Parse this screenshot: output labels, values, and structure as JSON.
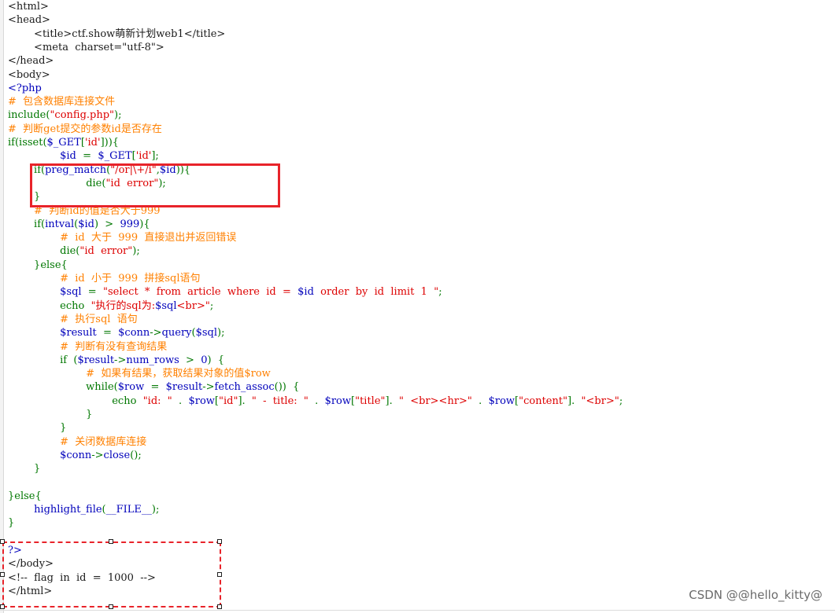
{
  "colors": {
    "default": "#1a1a1a",
    "tag": "#1a1a1a",
    "php": "#0000bb",
    "keyword": "#007700",
    "string": "#dd0000",
    "comment": "#ff8000",
    "highlight_box": "#e8232a"
  },
  "code_lines": [
    [
      {
        "t": "<html>",
        "c": "default"
      }
    ],
    [
      {
        "t": "<head>",
        "c": "default"
      }
    ],
    [
      {
        "t": "        <title>ctf.show萌新计划web1</title>",
        "c": "default"
      }
    ],
    [
      {
        "t": "        <meta  charset=\"utf-8\">",
        "c": "default"
      }
    ],
    [
      {
        "t": "</head>",
        "c": "default"
      }
    ],
    [
      {
        "t": "<body>",
        "c": "default"
      }
    ],
    [
      {
        "t": "<?php",
        "c": "php"
      }
    ],
    [
      {
        "t": "#  包含数据库连接文件",
        "c": "comment"
      }
    ],
    [
      {
        "t": "include(",
        "c": "keyword"
      },
      {
        "t": "\"config.php\"",
        "c": "string"
      },
      {
        "t": ");",
        "c": "keyword"
      }
    ],
    [
      {
        "t": "#  判断get提交的参数id是否存在",
        "c": "comment"
      }
    ],
    [
      {
        "t": "if(isset(",
        "c": "keyword"
      },
      {
        "t": "$_GET",
        "c": "php"
      },
      {
        "t": "[",
        "c": "keyword"
      },
      {
        "t": "'id'",
        "c": "string"
      },
      {
        "t": "])){",
        "c": "keyword"
      }
    ],
    [
      {
        "t": "                ",
        "c": "default"
      },
      {
        "t": "$id",
        "c": "php"
      },
      {
        "t": "  =  ",
        "c": "keyword"
      },
      {
        "t": "$_GET",
        "c": "php"
      },
      {
        "t": "[",
        "c": "keyword"
      },
      {
        "t": "'id'",
        "c": "string"
      },
      {
        "t": "];",
        "c": "keyword"
      }
    ],
    [
      {
        "t": "        if(",
        "c": "keyword"
      },
      {
        "t": "preg_match",
        "c": "php"
      },
      {
        "t": "(",
        "c": "keyword"
      },
      {
        "t": "\"/or|\\+/i\"",
        "c": "string"
      },
      {
        "t": ",",
        "c": "keyword"
      },
      {
        "t": "$id",
        "c": "php"
      },
      {
        "t": ")){",
        "c": "keyword"
      }
    ],
    [
      {
        "t": "                        ",
        "c": "default"
      },
      {
        "t": "die(",
        "c": "keyword"
      },
      {
        "t": "\"id  error\"",
        "c": "string"
      },
      {
        "t": ");",
        "c": "keyword"
      }
    ],
    [
      {
        "t": "        }",
        "c": "keyword"
      }
    ],
    [
      {
        "t": "        #  判断id的值是否大于999",
        "c": "comment"
      }
    ],
    [
      {
        "t": "        if(",
        "c": "keyword"
      },
      {
        "t": "intval",
        "c": "php"
      },
      {
        "t": "(",
        "c": "keyword"
      },
      {
        "t": "$id",
        "c": "php"
      },
      {
        "t": ")  >  ",
        "c": "keyword"
      },
      {
        "t": "999",
        "c": "php"
      },
      {
        "t": "){",
        "c": "keyword"
      }
    ],
    [
      {
        "t": "                #  id  大于  999  直接退出并返回错误",
        "c": "comment"
      }
    ],
    [
      {
        "t": "                ",
        "c": "default"
      },
      {
        "t": "die(",
        "c": "keyword"
      },
      {
        "t": "\"id  error\"",
        "c": "string"
      },
      {
        "t": ");",
        "c": "keyword"
      }
    ],
    [
      {
        "t": "        }else{",
        "c": "keyword"
      }
    ],
    [
      {
        "t": "                #  id  小于  999  拼接sql语句",
        "c": "comment"
      }
    ],
    [
      {
        "t": "                ",
        "c": "default"
      },
      {
        "t": "$sql",
        "c": "php"
      },
      {
        "t": "  =  ",
        "c": "keyword"
      },
      {
        "t": "\"select  *  from  article  where  id  =  ",
        "c": "string"
      },
      {
        "t": "$id",
        "c": "php"
      },
      {
        "t": "  order  by  id  limit  1  \"",
        "c": "string"
      },
      {
        "t": ";",
        "c": "keyword"
      }
    ],
    [
      {
        "t": "                ",
        "c": "default"
      },
      {
        "t": "echo  ",
        "c": "keyword"
      },
      {
        "t": "\"执行的sql为:",
        "c": "string"
      },
      {
        "t": "$sql",
        "c": "php"
      },
      {
        "t": "<br>\"",
        "c": "string"
      },
      {
        "t": ";",
        "c": "keyword"
      }
    ],
    [
      {
        "t": "                #  执行sql  语句",
        "c": "comment"
      }
    ],
    [
      {
        "t": "                ",
        "c": "default"
      },
      {
        "t": "$result",
        "c": "php"
      },
      {
        "t": "  =  ",
        "c": "keyword"
      },
      {
        "t": "$conn",
        "c": "php"
      },
      {
        "t": "->",
        "c": "keyword"
      },
      {
        "t": "query",
        "c": "php"
      },
      {
        "t": "(",
        "c": "keyword"
      },
      {
        "t": "$sql",
        "c": "php"
      },
      {
        "t": ");",
        "c": "keyword"
      }
    ],
    [
      {
        "t": "                #  判断有没有查询结果",
        "c": "comment"
      }
    ],
    [
      {
        "t": "                if  (",
        "c": "keyword"
      },
      {
        "t": "$result",
        "c": "php"
      },
      {
        "t": "->",
        "c": "keyword"
      },
      {
        "t": "num_rows",
        "c": "php"
      },
      {
        "t": "  >  ",
        "c": "keyword"
      },
      {
        "t": "0",
        "c": "php"
      },
      {
        "t": ")  {",
        "c": "keyword"
      }
    ],
    [
      {
        "t": "                        #  如果有结果，获取结果对象的值$row",
        "c": "comment"
      }
    ],
    [
      {
        "t": "                        while(",
        "c": "keyword"
      },
      {
        "t": "$row",
        "c": "php"
      },
      {
        "t": "  =  ",
        "c": "keyword"
      },
      {
        "t": "$result",
        "c": "php"
      },
      {
        "t": "->",
        "c": "keyword"
      },
      {
        "t": "fetch_assoc",
        "c": "php"
      },
      {
        "t": "())  {",
        "c": "keyword"
      }
    ],
    [
      {
        "t": "                                ",
        "c": "default"
      },
      {
        "t": "echo  ",
        "c": "keyword"
      },
      {
        "t": "\"id:  \"",
        "c": "string"
      },
      {
        "t": "  .  ",
        "c": "keyword"
      },
      {
        "t": "$row",
        "c": "php"
      },
      {
        "t": "[",
        "c": "keyword"
      },
      {
        "t": "\"id\"",
        "c": "string"
      },
      {
        "t": "].  ",
        "c": "keyword"
      },
      {
        "t": "\"  -  title:  \"",
        "c": "string"
      },
      {
        "t": "  .  ",
        "c": "keyword"
      },
      {
        "t": "$row",
        "c": "php"
      },
      {
        "t": "[",
        "c": "keyword"
      },
      {
        "t": "\"title\"",
        "c": "string"
      },
      {
        "t": "].  ",
        "c": "keyword"
      },
      {
        "t": "\"  <br><hr>\"",
        "c": "string"
      },
      {
        "t": "  .  ",
        "c": "keyword"
      },
      {
        "t": "$row",
        "c": "php"
      },
      {
        "t": "[",
        "c": "keyword"
      },
      {
        "t": "\"content\"",
        "c": "string"
      },
      {
        "t": "].  ",
        "c": "keyword"
      },
      {
        "t": "\"<br>\"",
        "c": "string"
      },
      {
        "t": ";",
        "c": "keyword"
      }
    ],
    [
      {
        "t": "                        }",
        "c": "keyword"
      }
    ],
    [
      {
        "t": "                }",
        "c": "keyword"
      }
    ],
    [
      {
        "t": "                #  关闭数据库连接",
        "c": "comment"
      }
    ],
    [
      {
        "t": "                ",
        "c": "default"
      },
      {
        "t": "$conn",
        "c": "php"
      },
      {
        "t": "->",
        "c": "keyword"
      },
      {
        "t": "close",
        "c": "php"
      },
      {
        "t": "();",
        "c": "keyword"
      }
    ],
    [
      {
        "t": "        }",
        "c": "keyword"
      }
    ],
    [
      {
        "t": "",
        "c": "default"
      }
    ],
    [
      {
        "t": "}else{",
        "c": "keyword"
      }
    ],
    [
      {
        "t": "        ",
        "c": "default"
      },
      {
        "t": "highlight_file",
        "c": "php"
      },
      {
        "t": "(",
        "c": "keyword"
      },
      {
        "t": "__FILE__",
        "c": "php"
      },
      {
        "t": ");",
        "c": "keyword"
      }
    ],
    [
      {
        "t": "}",
        "c": "keyword"
      }
    ],
    [
      {
        "t": "",
        "c": "default"
      }
    ],
    [
      {
        "t": "?>",
        "c": "php"
      }
    ],
    [
      {
        "t": "</body>",
        "c": "default"
      }
    ],
    [
      {
        "t": "<!--  flag  in  id  =  1000  -->",
        "c": "default"
      }
    ],
    [
      {
        "t": "</html>",
        "c": "default"
      }
    ]
  ],
  "watermark": "CSDN @@hello_kitty@"
}
